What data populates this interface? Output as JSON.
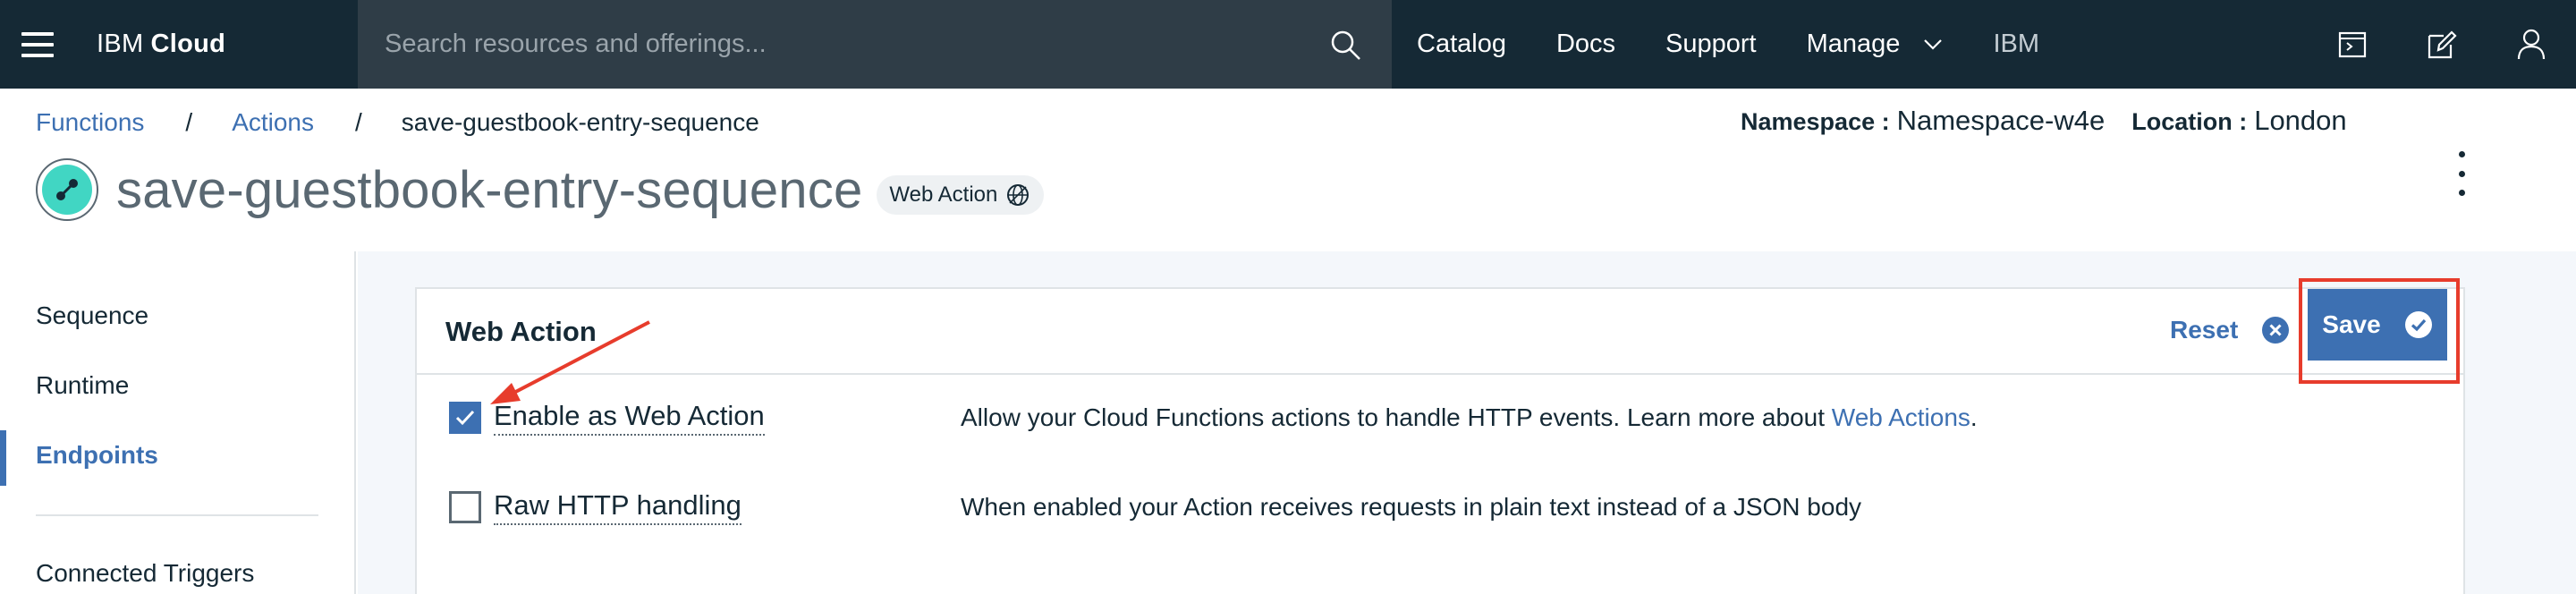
{
  "topbar": {
    "brand_ibm": "IBM",
    "brand_cloud": "Cloud",
    "search_placeholder": "Search resources and offerings...",
    "nav": [
      {
        "label": "Catalog"
      },
      {
        "label": "Docs"
      },
      {
        "label": "Support"
      },
      {
        "label": "Manage"
      }
    ],
    "account": "IBM",
    "icons": [
      "shell-icon",
      "edit-icon",
      "user-icon"
    ]
  },
  "breadcrumb": {
    "items": [
      "Functions",
      "Actions"
    ],
    "separator": "/",
    "current": "save-guestbook-entry-sequence"
  },
  "meta": {
    "namespace_key": "Namespace :",
    "namespace_value": "Namespace-w4e",
    "location_key": "Location :",
    "location_value": "London"
  },
  "page": {
    "title": "save-guestbook-entry-sequence",
    "tag": "Web Action"
  },
  "sidenav": {
    "items": [
      {
        "label": "Sequence"
      },
      {
        "label": "Runtime"
      },
      {
        "label": "Endpoints",
        "active": true
      },
      {
        "label": "Connected Triggers"
      }
    ]
  },
  "card": {
    "title": "Web Action",
    "reset_label": "Reset",
    "save_label": "Save",
    "options": [
      {
        "label": "Enable as Web Action",
        "checked": true,
        "description": "Allow your Cloud Functions actions to handle HTTP events. Learn more about ",
        "link": "Web Actions",
        "suffix": "."
      },
      {
        "label": "Raw HTTP handling",
        "checked": false,
        "description": "When enabled your Action receives requests in plain text instead of a JSON body"
      }
    ]
  },
  "colors": {
    "topbar": "#152935",
    "search": "#2f3d47",
    "accent": "#3d70b2",
    "annotation": "#e73c2c",
    "teal": "#41d6c3"
  }
}
